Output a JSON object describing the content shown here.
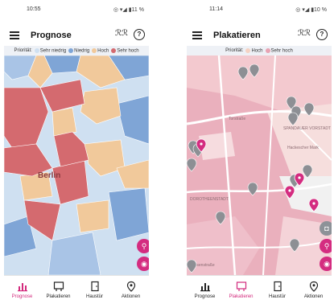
{
  "screen1": {
    "status_time": "10:55",
    "status_icons": "◎ ▾◢ ▮11 %",
    "title": "Prognose",
    "legend": {
      "label": "Priorität:",
      "items": [
        {
          "label": "Sehr niedrig",
          "color": "#cfe0f1"
        },
        {
          "label": "Niedrig",
          "color": "#7fa5d6"
        },
        {
          "label": "Hoch",
          "color": "#f1c99b"
        },
        {
          "label": "Sehr hoch",
          "color": "#d46a6f"
        }
      ]
    },
    "map_label": "Berlin"
  },
  "screen2": {
    "status_time": "11:14",
    "status_icons": "◎ ▾◢ ▮10 %",
    "title": "Plakatieren",
    "legend": {
      "label": "Priorität:",
      "items": [
        {
          "label": "Hoch",
          "color": "#f5d2c3"
        },
        {
          "label": "Sehr hoch",
          "color": "#e8a3b3"
        }
      ]
    },
    "map_labels": [
      "SPANDAUER VORSTADT",
      "Hackescher Mark",
      "DOROTHEENSTADT",
      "Torstraße",
      "Rosenstraße"
    ]
  },
  "tabs": [
    {
      "label": "Prognose",
      "icon": "chart-icon"
    },
    {
      "label": "Plakatieren",
      "icon": "poster-icon"
    },
    {
      "label": "Haustür",
      "icon": "door-icon"
    },
    {
      "label": "Aktionen",
      "icon": "location-pin-icon"
    }
  ],
  "colors": {
    "accent": "#d42c80",
    "active_tab": "#d32a7d"
  }
}
